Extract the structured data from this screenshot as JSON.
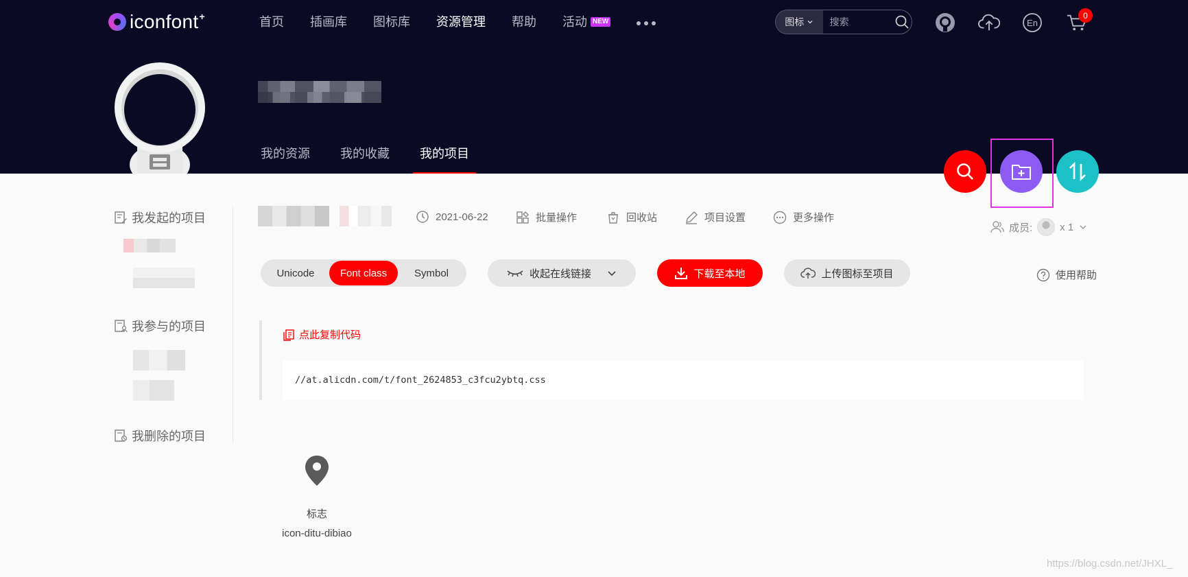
{
  "header": {
    "logo_text": "iconfont",
    "logo_plus": "+",
    "nav": [
      {
        "label": "首页",
        "active": false
      },
      {
        "label": "插画库",
        "active": false
      },
      {
        "label": "图标库",
        "active": false
      },
      {
        "label": "资源管理",
        "active": true
      },
      {
        "label": "帮助",
        "active": false
      },
      {
        "label": "活动",
        "active": false,
        "badge": "NEW"
      }
    ],
    "search": {
      "type_label": "图标",
      "placeholder": "搜索"
    },
    "cart_count": "0",
    "lang_label": "En"
  },
  "profile": {
    "tabs": [
      {
        "label": "我的资源",
        "active": false
      },
      {
        "label": "我的收藏",
        "active": false
      },
      {
        "label": "我的项目",
        "active": true
      }
    ]
  },
  "sidebar": {
    "sections": [
      {
        "label": "我发起的项目"
      },
      {
        "label": "我参与的项目"
      },
      {
        "label": "我删除的项目"
      }
    ]
  },
  "project": {
    "date": "2021-06-22",
    "actions": [
      {
        "label": "批量操作",
        "icon": "batch-icon"
      },
      {
        "label": "回收站",
        "icon": "trash-icon"
      },
      {
        "label": "项目设置",
        "icon": "edit-icon"
      },
      {
        "label": "更多操作",
        "icon": "more-icon"
      }
    ],
    "members_label": "成员:",
    "members_count": "x 1"
  },
  "toolbar": {
    "modes": [
      {
        "label": "Unicode",
        "active": false
      },
      {
        "label": "Font class",
        "active": true
      },
      {
        "label": "Symbol",
        "active": false
      }
    ],
    "collapse_label": "收起在线链接",
    "download_label": "下载至本地",
    "upload_label": "上传图标至项目",
    "help_label": "使用帮助"
  },
  "code": {
    "copy_label": "点此复制代码",
    "url": "//at.alicdn.com/t/font_2624853_c3fcu2ybtq.css"
  },
  "icons": [
    {
      "name": "标志",
      "class_name": "icon-ditu-dibiao",
      "glyph": "map-pin-icon"
    }
  ],
  "watermark": "https://blog.csdn.net/JHXL_",
  "colors": {
    "header_bg": "#0b0a24",
    "accent_red": "#ff0000",
    "fab_purple": "#8d5af2",
    "fab_teal": "#1bc1c6",
    "highlight": "#e332e3"
  }
}
